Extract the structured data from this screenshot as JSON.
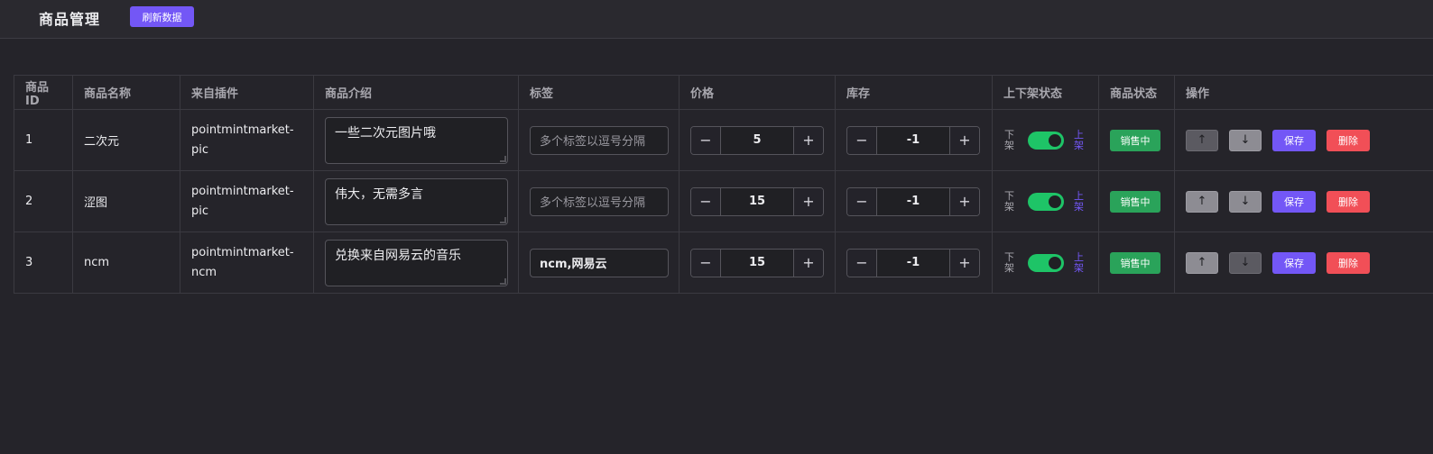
{
  "header": {
    "title": "商品管理",
    "refresh_label": "刷新数据"
  },
  "table": {
    "columns": [
      "商品ID",
      "商品名称",
      "来自插件",
      "商品介绍",
      "标签",
      "价格",
      "库存",
      "上下架状态",
      "商品状态",
      "操作"
    ],
    "tag_placeholder": "多个标签以逗号分隔",
    "rows": [
      {
        "id": "1",
        "name": "二次元",
        "plugin": "pointmintmarket-pic",
        "description": "一些二次元图片哦",
        "tags": "",
        "price": "5",
        "stock": "-1",
        "off_label": "下架",
        "on_label": "上架",
        "shelf_on": true,
        "status": "销售中",
        "up": "↑",
        "down": "↓",
        "save": "保存",
        "delete": "删除"
      },
      {
        "id": "2",
        "name": "涩图",
        "plugin": "pointmintmarket-pic",
        "description": "伟大，无需多言",
        "tags": "",
        "price": "15",
        "stock": "-1",
        "off_label": "下架",
        "on_label": "上架",
        "shelf_on": true,
        "status": "销售中",
        "up": "↑",
        "down": "↓",
        "save": "保存",
        "delete": "删除"
      },
      {
        "id": "3",
        "name": "ncm",
        "plugin": "pointmintmarket-ncm",
        "description": "兑换来自网易云的音乐",
        "tags": "ncm,网易云",
        "price": "15",
        "stock": "-1",
        "off_label": "下架",
        "on_label": "上架",
        "shelf_on": true,
        "status": "销售中",
        "up": "↑",
        "down": "↓",
        "save": "保存",
        "delete": "删除"
      }
    ]
  },
  "icons": {
    "minus": "minus-icon",
    "plus": "plus-icon",
    "arrow_up": "arrow-up-icon",
    "arrow_down": "arrow-down-icon"
  },
  "colors": {
    "accent": "#7357f6",
    "toggle_on": "#1ec467",
    "status_green": "#2aa35a",
    "delete_red": "#f14f57"
  }
}
